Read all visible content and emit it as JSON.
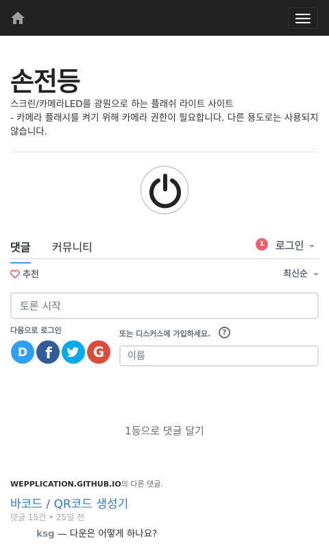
{
  "navbar": {
    "home_icon": "home-icon",
    "menu_icon": "hamburger-icon",
    "bg_color": "#222222"
  },
  "page": {
    "title": "손전등",
    "description_line1": "스크린/카메라LED를 광원으로 하는 플래쉬 라이트 사이트",
    "description_line2": "- 카메라 플래시를 켜기 위해 카메라 권한이 필요합니다. 다른 용도로는 사용되지 않습니다.",
    "power_icon": "power-icon"
  },
  "disqus": {
    "tabs": [
      {
        "label": "댓글",
        "active": true
      },
      {
        "label": "커뮤니티",
        "active": false
      }
    ],
    "notification_count": "1",
    "login_label": "로그인",
    "recommend_label": "추천",
    "sort_label": "최신순",
    "comment_placeholder": "토론 시작",
    "login_with_label": "다음으로 로그인",
    "social": [
      "disqus-icon",
      "facebook-icon",
      "twitter-icon",
      "google-icon"
    ],
    "or_signup_label": "또는 디스커스에 가입하세요.",
    "help_label": "?",
    "name_placeholder": "이름",
    "first_comment_label": "1등으로 댓글 달기",
    "also_on_site": "WEPPLICATION.GITHUB.IO",
    "also_on_suffix": "의 다른 댓글.",
    "related": {
      "title": "바코드 / QR코드 생성기",
      "comments": "댓글 15건",
      "dot": "•",
      "age": "25일 전",
      "comment_author": "ksg",
      "comment_text": "— 다운은 어떻게 하나요?"
    },
    "colors": {
      "accent": "#2e9fff",
      "badge": "#f05f70",
      "link": "#2e7bc4"
    }
  }
}
